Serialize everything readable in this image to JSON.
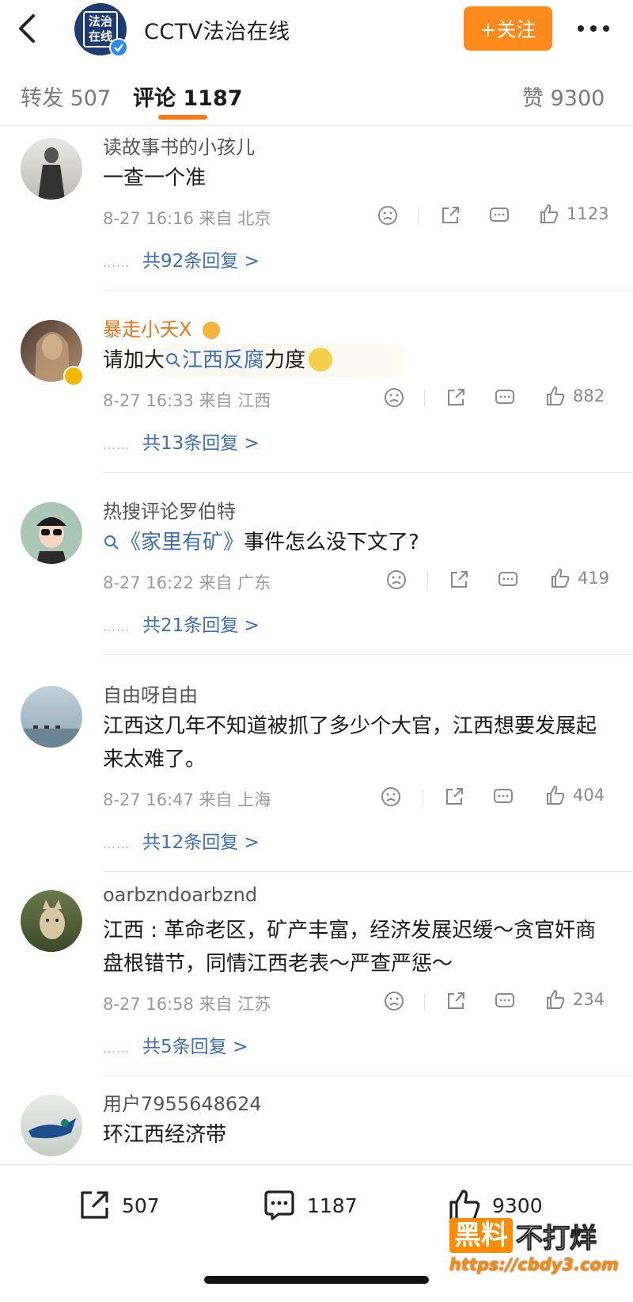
{
  "header": {
    "account_name": "CCTV法治在线",
    "avatar_text": "法治在线",
    "follow_label": "+关注"
  },
  "tabs": {
    "repost": "转发 507",
    "comments": "评论 1187",
    "likes": "赞 9300"
  },
  "comments": [
    {
      "user": "读故事书的小孩儿",
      "text": "一查一个准",
      "time": "8-27 16:16",
      "source": "来自 北京",
      "likes": "1123",
      "replies": "共92条回复 >"
    },
    {
      "user": "暴走小夭X",
      "text_prefix": "请加大",
      "text_link": "江西反腐",
      "text_suffix": "力度",
      "time": "8-27 16:33",
      "source": "来自 江西",
      "likes": "882",
      "replies": "共13条回复 >"
    },
    {
      "user": "热搜评论罗伯特",
      "text_link": "《家里有矿》",
      "text_suffix": "事件怎么没下文了?",
      "time": "8-27 16:22",
      "source": "来自 广东",
      "likes": "419",
      "replies": "共21条回复 >"
    },
    {
      "user": "自由呀自由",
      "text": "江西这几年不知道被抓了多少个大官，江西想要发展起来太难了。",
      "time": "8-27 16:47",
      "source": "来自 上海",
      "likes": "404",
      "replies": "共12条回复 >"
    },
    {
      "user": "oarbzndoarbznd",
      "text": "江西 :  革命老区，矿产丰富，经济发展迟缓～贪官奸商盘根错节，同情江西老表～严查严惩～",
      "time": "8-27 16:58",
      "source": "来自 江苏",
      "likes": "234",
      "replies": "共5条回复 >"
    },
    {
      "user": "用户7955648624",
      "text": "环江西经济带"
    }
  ],
  "bottom": {
    "repost": "507",
    "comments": "1187",
    "likes": "9300"
  },
  "watermark": {
    "box": "黑料",
    "rest": "不打烊",
    "url": "https://cbdy3.com"
  },
  "icons": [
    "back-icon",
    "verified-icon",
    "more-icon",
    "dislike-icon",
    "share-icon",
    "comment-icon",
    "like-icon",
    "search-icon"
  ],
  "colors": {
    "accent": "#ff8a1c",
    "link": "#3e6fb6",
    "vip_name": "#f07516"
  }
}
